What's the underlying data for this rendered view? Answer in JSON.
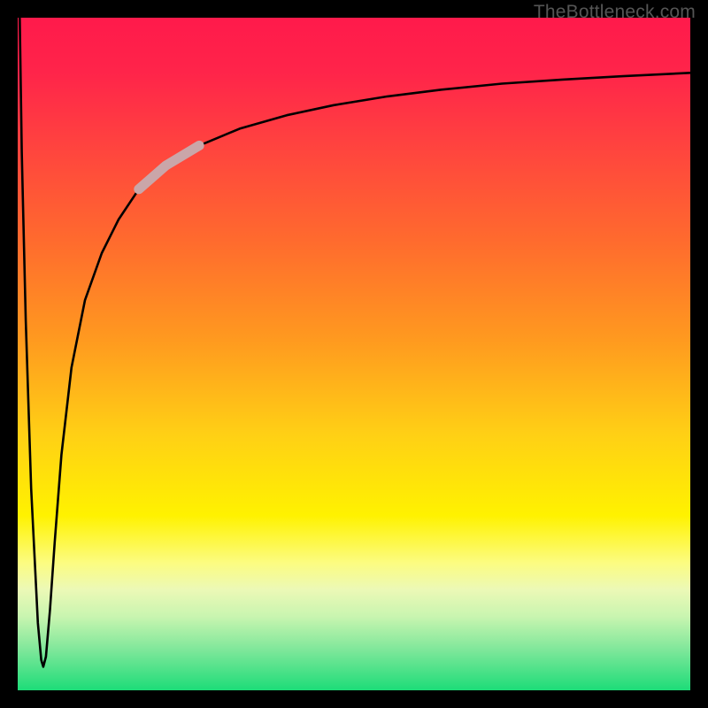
{
  "attribution": "TheBottleneck.com",
  "chart_data": {
    "type": "line",
    "title": "",
    "xlabel": "",
    "ylabel": "",
    "xlim": [
      0,
      100
    ],
    "ylim": [
      0,
      100
    ],
    "grid": false,
    "annotations": [
      "highlighted segment on curve"
    ],
    "series": [
      {
        "name": "curve",
        "x": [
          0.3,
          0.6,
          1.2,
          2.0,
          3.0,
          3.5,
          3.8,
          4.2,
          4.8,
          5.5,
          6.5,
          8.0,
          10.0,
          12.5,
          15.0,
          18.0,
          22.0,
          27.0,
          33.0,
          40.0,
          47.0,
          55.0,
          63.0,
          72.0,
          81.0,
          90.0,
          100.0
        ],
        "y": [
          100,
          80,
          55,
          30,
          10,
          4.5,
          3.5,
          5.0,
          12,
          22,
          35,
          48,
          58,
          65,
          70,
          74.5,
          78,
          81,
          83.5,
          85.5,
          87,
          88.3,
          89.3,
          90.2,
          90.8,
          91.3,
          91.8
        ]
      }
    ],
    "highlight": {
      "series": "curve",
      "x_start": 18.0,
      "x_end": 27.0,
      "color": "#caa6a9"
    }
  }
}
